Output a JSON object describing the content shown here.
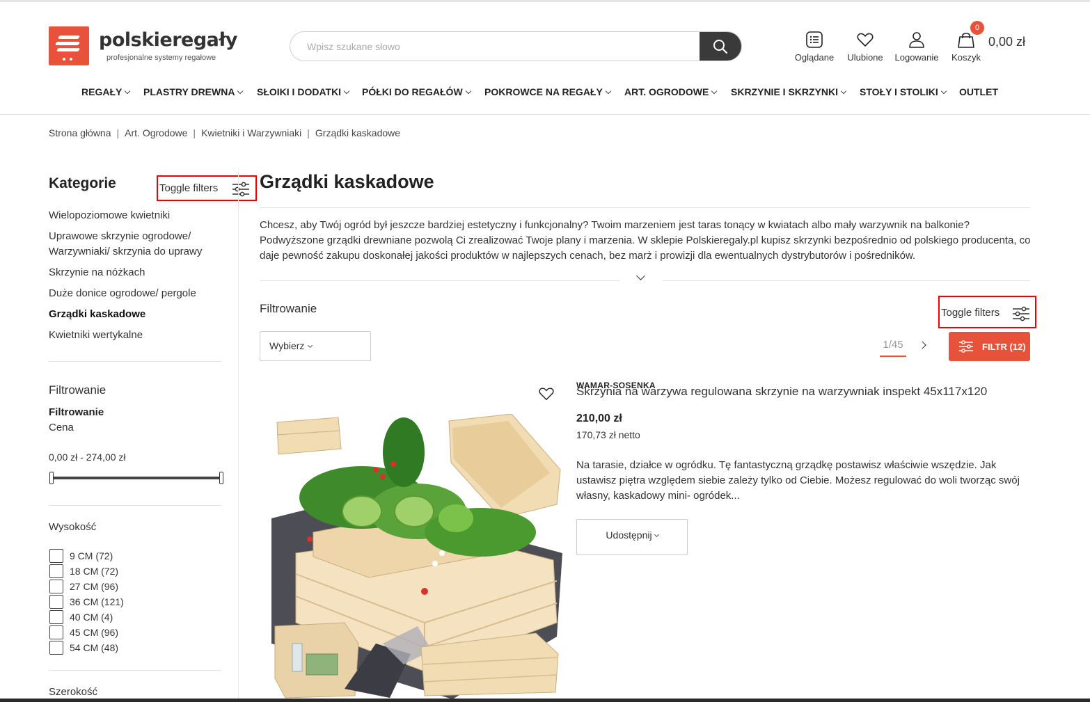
{
  "brand": {
    "name": "polskieregały",
    "tagline": "profesjonalne systemy regałowe",
    "accent_color": "#e8513a"
  },
  "search": {
    "placeholder": "Wpisz szukane słowo"
  },
  "header_icons": {
    "viewed": "Oglądane",
    "favorites": "Ulubione",
    "login": "Logowanie",
    "cart": "Koszyk",
    "cart_count": "0",
    "cart_total": "0,00 zł"
  },
  "nav": {
    "items": [
      {
        "label": "REGAŁY"
      },
      {
        "label": "PLASTRY DREWNA"
      },
      {
        "label": "SŁOIKI I DODATKI"
      },
      {
        "label": "PÓŁKI DO REGAŁÓW"
      },
      {
        "label": "POKROWCE NA REGAŁY"
      },
      {
        "label": "ART. OGRODOWE"
      },
      {
        "label": "SKRZYNIE I SKRZYNKI"
      },
      {
        "label": "STOŁY I STOLIKI"
      },
      {
        "label": "OUTLET"
      }
    ]
  },
  "breadcrumb": [
    "Strona główna",
    "Art. Ogrodowe",
    "Kwietniki i Warzywniaki",
    "Grządki kaskadowe"
  ],
  "sidebar": {
    "title": "Kategorie",
    "toggle_label": "Toggle filters",
    "categories": [
      "Wielopoziomowe kwietniki",
      "Uprawowe skrzynie ogrodowe/ Warzywniaki/ skrzynia do uprawy",
      "Skrzynie na nóżkach",
      "Duże donice ogrodowe/ pergole",
      "Grządki kaskadowe",
      "Kwietniki wertykalne"
    ],
    "filter_heading": "Filtrowanie",
    "filter_sub": "Filtrowanie",
    "price_label": "Cena",
    "price_range": "0,00 zł - 274,00 zł",
    "height_heading": "Wysokość",
    "height_options": [
      "9 CM (72)",
      "18 CM (72)",
      "27 CM (96)",
      "36 CM (121)",
      "40 CM (4)",
      "45 CM (96)",
      "54 CM (48)"
    ],
    "width_heading": "Szerokość"
  },
  "main": {
    "title": "Grządki kaskadowe",
    "description": "Chcesz, aby Twój ogród był jeszcze bardziej estetyczny i funkcjonalny? Twoim marzeniem jest taras tonący w kwiatach albo mały warzywnik na balkonie? Podwyższone grządki drewniane pozwolą Ci zrealizować Twoje plany i marzenia. W sklepie Polskieregaly.pl kupisz skrzynki bezpośrednio od polskiego producenta, co daje pewność zakupu doskonałej jakości produktów w najlepszych cenach, bez marż i prowizji dla ewentualnych dystrybutorów i pośredników.",
    "filter_label": "Filtrowanie",
    "toggle_label": "Toggle filters",
    "sort_value": "Wybierz",
    "pager": "1/45",
    "filter_button": "FILTR (12)"
  },
  "product": {
    "brand": "WAMAR-SOSENKA",
    "name": "Skrzynia na warzywa regulowana skrzynie na warzywniak inspekt 45x117x120",
    "price": "210,00 zł",
    "price_netto": "170,73 zł netto",
    "description": "Na tarasie, działce w ogródku. Tę fantastyczną grządkę postawisz właściwie wszędzie. Jak ustawisz piętra względem siebie zależy tylko od Ciebie. Możesz regulować do woli tworząc swój własny, kaskadowy mini- ogródek...",
    "share_label": "Udostępnij"
  }
}
